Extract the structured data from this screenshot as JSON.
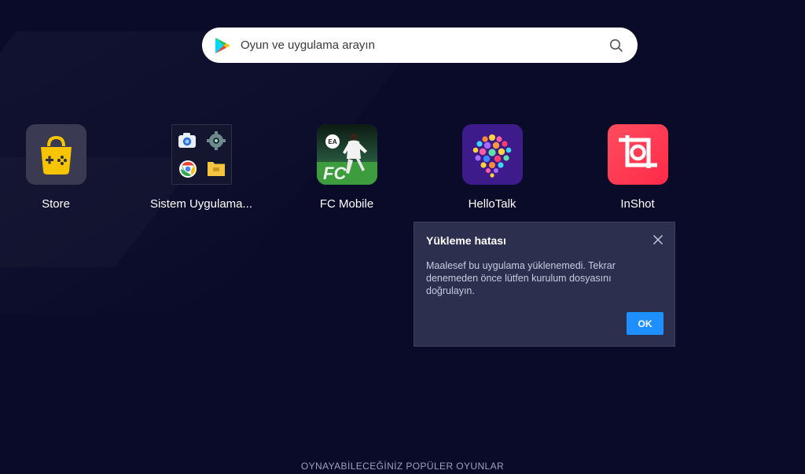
{
  "search": {
    "placeholder": "Oyun ve uygulama arayın"
  },
  "apps": [
    {
      "label": "Store",
      "icon": "store-gamepad-bag-icon"
    },
    {
      "label": "Sistem Uygulama...",
      "icon": "system-apps-folder-icon"
    },
    {
      "label": "FC Mobile",
      "icon": "fc-mobile-icon"
    },
    {
      "label": "HelloTalk",
      "icon": "hellotalk-icon"
    },
    {
      "label": "InShot",
      "icon": "inshot-icon"
    }
  ],
  "dialog": {
    "title": "Yükleme hatası",
    "message": "Maalesef bu uygulama yüklenemedi. Tekrar denemeden önce lütfen kurulum dosyasını doğrulayın.",
    "ok_label": "OK"
  },
  "bottom": {
    "heading": "OYNAYABİLECEĞİNİZ POPÜLER OYUNLAR"
  },
  "colors": {
    "background": "#090b29",
    "dialog_background": "#2c2f4e",
    "accent": "#1e8fff"
  }
}
